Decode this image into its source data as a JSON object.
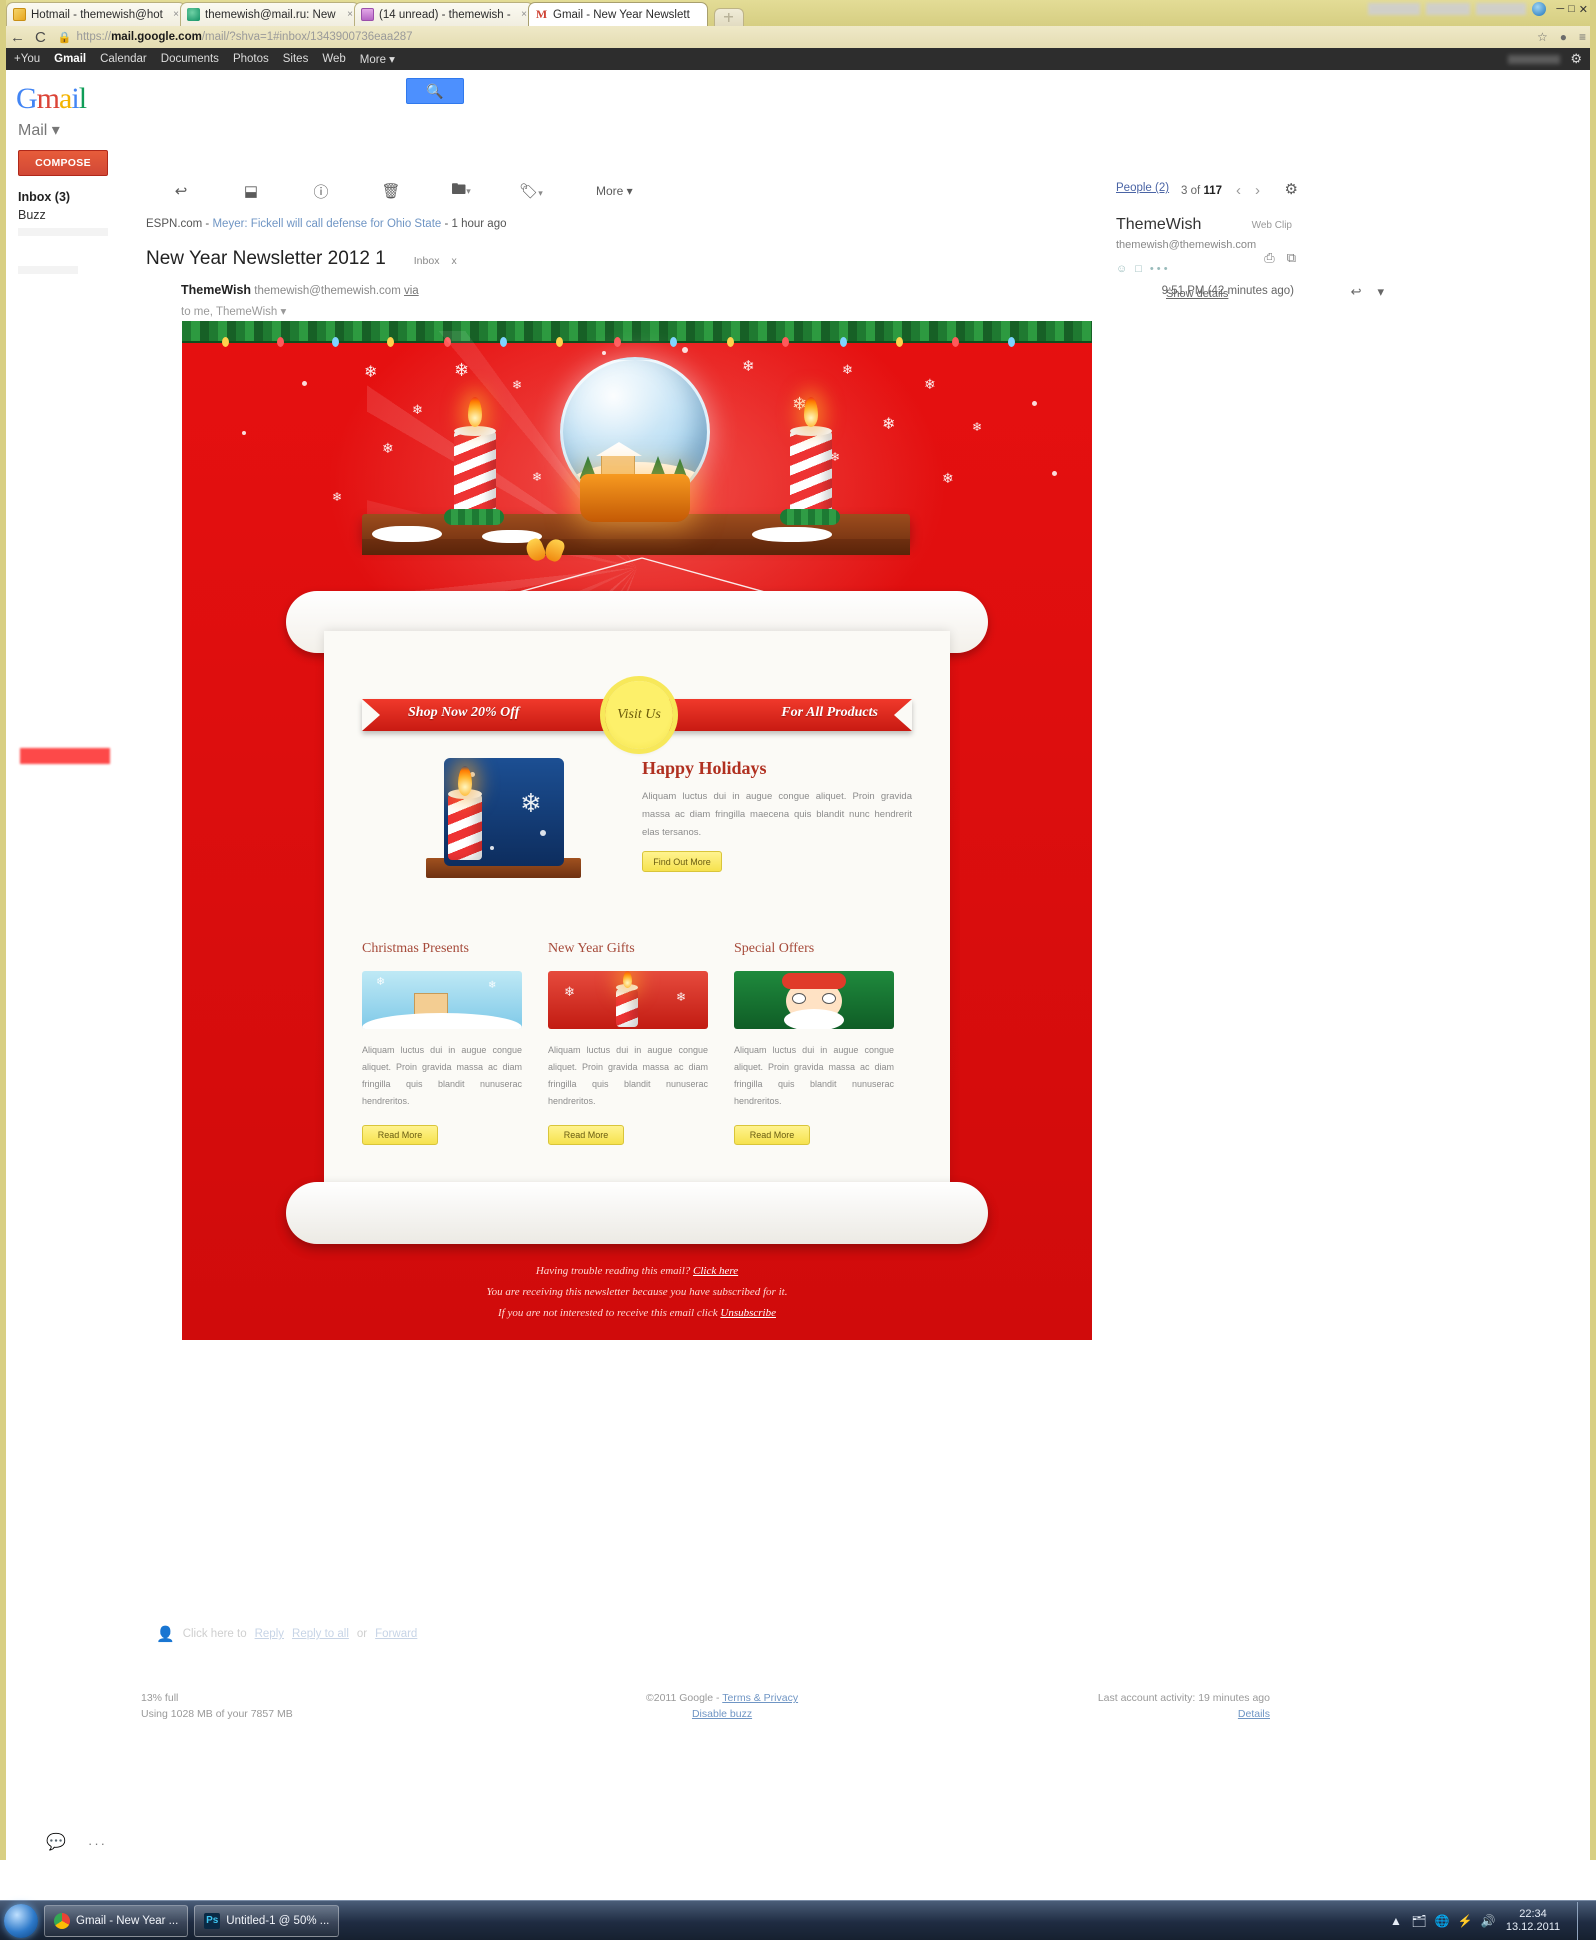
{
  "browser": {
    "tabs": [
      {
        "title": "Hotmail - themewish@hot",
        "favicon": "hotmail-icon",
        "active": false
      },
      {
        "title": "themewish@mail.ru: New",
        "favicon": "mailru-icon",
        "active": false
      },
      {
        "title": "(14 unread) - themewish -",
        "favicon": "vk-icon",
        "active": false
      },
      {
        "title": "Gmail - New Year Newslett",
        "favicon": "gmail-icon",
        "active": true
      }
    ],
    "close_glyph": "×",
    "back_glyph": "←",
    "reload_glyph": "C",
    "lock_glyph": "🔒",
    "url": {
      "scheme": "https://",
      "host": "mail.google.com",
      "path": "/mail/?shva=1#inbox/1343900736eaa287"
    },
    "star_glyph": "☆",
    "wrench_glyph": "≡"
  },
  "google_bar": {
    "items": [
      "+You",
      "Gmail",
      "Calendar",
      "Documents",
      "Photos",
      "Sites",
      "Web",
      "More ▾"
    ],
    "active": "Gmail",
    "gear_glyph": "⚙"
  },
  "gmail": {
    "logo": "Gmail",
    "search_icon": "search-icon",
    "mail_dropdown": "Mail ▾",
    "compose_label": "COMPOSE",
    "sidebar": [
      {
        "label": "Inbox (3)",
        "bold": true
      },
      {
        "label": "Buzz",
        "bold": false
      }
    ],
    "toolbar": {
      "back_glyph": "↩",
      "archive_glyph": "⬓",
      "spam_glyph": "ⓘ",
      "delete_glyph": "🗑",
      "move_glyph": "🖿",
      "label_glyph": "🏷",
      "more_label": "More ▾"
    },
    "pager": {
      "current": "3 of ",
      "total": "117",
      "prev_glyph": "‹",
      "next_glyph": "›",
      "gear_glyph": "⚙"
    },
    "webclip": {
      "source": "ESPN.com - ",
      "headline": "Meyer: Fickell will call defense for Ohio State",
      "time": " - 1 hour ago",
      "label": "Web Clip"
    },
    "thread": {
      "subject": "New Year Newsletter 2012 1",
      "label": "Inbox",
      "label_remove": "x",
      "print_glyph": "⎙",
      "popout_glyph": "⧉"
    },
    "message": {
      "sender_name": "ThemeWish",
      "sender_email": "themewish@themewish.com",
      "via": "via",
      "recipient": "to me, ThemeWish",
      "recipient_caret": "▾",
      "time": "9:51 PM (42 minutes ago)",
      "reply_glyph": "↩",
      "menu_glyph": "▾"
    },
    "people_panel": {
      "header": "People (2)",
      "name": "ThemeWish",
      "email": "themewish@themewish.com",
      "show_details": "Show details",
      "icon_glyphs": [
        "☺",
        "□",
        "• • •"
      ]
    },
    "message_footer": {
      "prefix": "Click here to",
      "reply": "Reply",
      "reply_all": "Reply to all",
      "or": "or",
      "forward": "Forward"
    },
    "footer": {
      "storage_percent": "13% full",
      "storage_usage": "Using 1028 MB of your 7857 MB",
      "copyright": "©2011 Google - ",
      "terms": "Terms & Privacy",
      "disable_buzz": "Disable buzz",
      "last_activity": "Last account activity: 19 minutes ago",
      "details": "Details"
    },
    "chat_glyph": "💬",
    "chat_dots": "···"
  },
  "newsletter": {
    "ribbon": {
      "left_text": "Shop Now 20% Off",
      "seal_text": "Visit Us",
      "right_text": "For All Products"
    },
    "feature": {
      "title": "Happy Holidays",
      "body": "Aliquam luctus dui in augue congue aliquet. Proin gravida massa ac diam fringilla maecena quis blandit nunc hendrerit elas tersanos.",
      "button": "Find Out More"
    },
    "columns": [
      {
        "title": "Christmas Presents",
        "thumb": "snow-village-thumb",
        "body": "Aliquam luctus dui in augue congue aliquet. Proin gravida massa ac diam fringilla quis blandit nunuserac hendreritos.",
        "button": "Read More"
      },
      {
        "title": "New Year Gifts",
        "thumb": "candle-thumb",
        "body": "Aliquam luctus dui in augue congue aliquet. Proin gravida massa ac diam fringilla quis blandit nunuserac hendreritos.",
        "button": "Read More"
      },
      {
        "title": "Special Offers",
        "thumb": "santa-thumb",
        "body": "Aliquam luctus dui in augue congue aliquet. Proin gravida massa ac diam fringilla quis blandit nunuserac hendreritos.",
        "button": "Read More"
      }
    ],
    "footer": {
      "line1_prefix": "Having trouble reading this email? ",
      "line1_link": "Click here",
      "line2": "You are receiving this newsletter because you have subscribed for it.",
      "line3_prefix": "If you are not interested to receive this email click ",
      "line3_link": "Unsubscribe"
    }
  },
  "taskbar": {
    "start_glyph": "⊚",
    "items": [
      {
        "label": "Gmail - New Year ...",
        "icon": "chrome-icon"
      },
      {
        "label": "Untitled-1 @ 50% ...",
        "icon": "photoshop-icon",
        "badge": "Ps"
      }
    ],
    "tray_glyphs": [
      "▲",
      "🗂",
      "🌐",
      "⚡",
      "🔊"
    ],
    "clock_time": "22:34",
    "clock_date": "13.12.2011"
  }
}
